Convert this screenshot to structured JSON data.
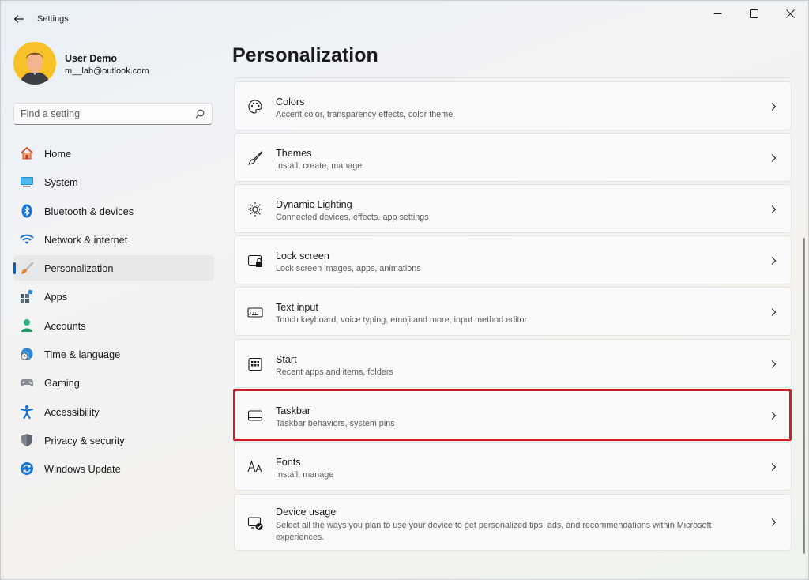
{
  "window": {
    "title": "Settings",
    "back_icon": "back-arrow-icon",
    "controls": [
      "minimize-icon",
      "maximize-icon",
      "close-icon"
    ]
  },
  "profile": {
    "name": "User Demo",
    "email": "m__lab@outlook.com",
    "avatar_bg": "#f6c026"
  },
  "search": {
    "placeholder": "Find a setting",
    "value": ""
  },
  "nav": {
    "items": [
      {
        "label": "Home",
        "icon": "home-icon"
      },
      {
        "label": "System",
        "icon": "system-monitor-icon"
      },
      {
        "label": "Bluetooth & devices",
        "icon": "bluetooth-icon"
      },
      {
        "label": "Network & internet",
        "icon": "wifi-icon"
      },
      {
        "label": "Personalization",
        "icon": "paintbrush-icon",
        "selected": true
      },
      {
        "label": "Apps",
        "icon": "apps-icon"
      },
      {
        "label": "Accounts",
        "icon": "accounts-icon"
      },
      {
        "label": "Time & language",
        "icon": "globe-clock-icon"
      },
      {
        "label": "Gaming",
        "icon": "gamepad-icon"
      },
      {
        "label": "Accessibility",
        "icon": "accessibility-icon"
      },
      {
        "label": "Privacy & security",
        "icon": "shield-icon"
      },
      {
        "label": "Windows Update",
        "icon": "update-icon"
      }
    ],
    "accent": "#0067c0"
  },
  "main": {
    "title": "Personalization",
    "cards": [
      {
        "title": "Colors",
        "desc": "Accent color, transparency effects, color theme",
        "icon": "palette-icon"
      },
      {
        "title": "Themes",
        "desc": "Install, create, manage",
        "icon": "brush-icon"
      },
      {
        "title": "Dynamic Lighting",
        "desc": "Connected devices, effects, app settings",
        "icon": "lighting-icon"
      },
      {
        "title": "Lock screen",
        "desc": "Lock screen images, apps, animations",
        "icon": "lock-screen-icon"
      },
      {
        "title": "Text input",
        "desc": "Touch keyboard, voice typing, emoji and more, input method editor",
        "icon": "keyboard-icon"
      },
      {
        "title": "Start",
        "desc": "Recent apps and items, folders",
        "icon": "start-icon"
      },
      {
        "title": "Taskbar",
        "desc": "Taskbar behaviors, system pins",
        "icon": "taskbar-icon",
        "highlighted": true
      },
      {
        "title": "Fonts",
        "desc": "Install, manage",
        "icon": "fonts-icon"
      },
      {
        "title": "Device usage",
        "desc": "Select all the ways you plan to use your device to get personalized tips, ads, and recommendations within Microsoft experiences.",
        "icon": "device-usage-icon"
      }
    ],
    "highlight_color": "#d01c24"
  }
}
